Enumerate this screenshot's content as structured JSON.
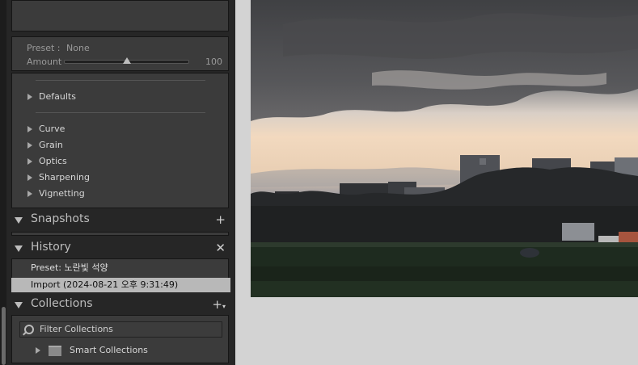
{
  "develop_panel": {
    "preset_label": "Preset :",
    "preset_value": "None",
    "amount_label": "Amount",
    "amount_value": "100",
    "amount_fraction": 0.5,
    "presets": {
      "defaults": "Defaults",
      "items": [
        "Curve",
        "Grain",
        "Optics",
        "Sharpening",
        "Vignetting"
      ]
    }
  },
  "snapshots": {
    "title": "Snapshots",
    "action_icon": "plus-icon"
  },
  "history": {
    "title": "History",
    "action_icon": "close-icon",
    "items": [
      "Preset: 노란빛 석양",
      "Import (2024-08-21 오후 9:31:49)"
    ]
  },
  "collections": {
    "title": "Collections",
    "action_icon": "plus-dropdown-icon",
    "filter_placeholder": "Filter Collections",
    "smart_collections": "Smart Collections"
  },
  "colors": {
    "panel_bg": "#3b3b3b",
    "history_selected": "#b8b8b8",
    "canvas_bg": "#d3d3d3"
  }
}
